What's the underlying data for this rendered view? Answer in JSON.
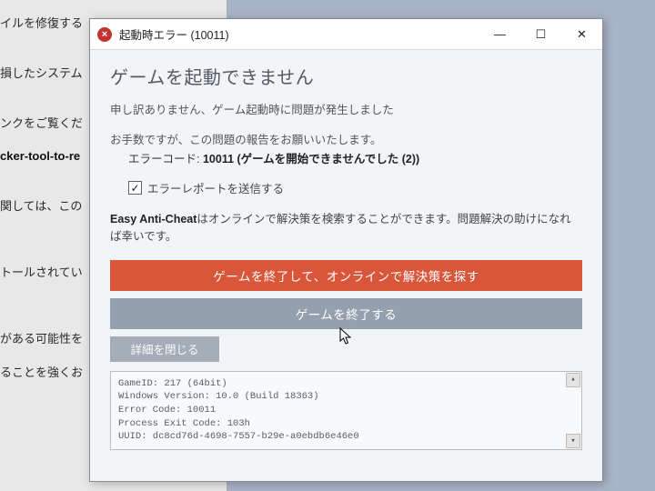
{
  "background": {
    "lines": [
      "イルを修復する",
      "損したシステム",
      "ンクをご覧くだ",
      "cker-tool-to-re",
      "関しては、この",
      "トールされてい",
      "がある可能性を",
      "ることを強くお"
    ]
  },
  "titlebar": {
    "title": "起動時エラー (10011)",
    "icon_glyph": "×"
  },
  "winbuttons": {
    "minimize": "—",
    "maximize": "☐",
    "close": "✕"
  },
  "dialog": {
    "heading": "ゲームを起動できません",
    "msg_apology": "申し訳ありません、ゲーム起動時に問題が発生しました",
    "msg_request": "お手数ですが、この問題の報告をお願いいたします。",
    "error_label": "エラーコード:",
    "error_value": "10011 (ゲームを開始できませんでした (2))",
    "checkbox_label": "エラーレポートを送信する",
    "eac_prefix": "Easy Anti-Cheat",
    "eac_text": "はオンラインで解決策を検索することができます。問題解決の助けになれば幸いです。",
    "btn_primary": "ゲームを終了して、オンラインで解決策を探す",
    "btn_secondary": "ゲームを終了する",
    "btn_details": "詳細を閉じる"
  },
  "details": {
    "l1": "GameID: 217 (64bit)",
    "l2": "Windows Version: 10.0 (Build 18363)",
    "l3": "Error Code: 10011",
    "l4": "Process Exit Code: 103h",
    "l5": "UUID: dc8cd76d-4698-7557-b29e-a0ebdb6e46e0"
  }
}
